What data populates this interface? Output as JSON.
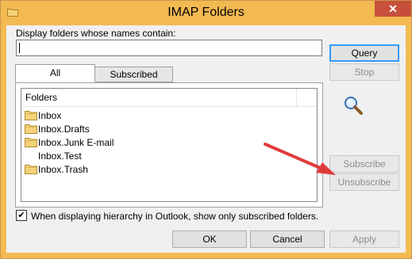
{
  "window": {
    "title": "IMAP Folders",
    "close_glyph": "✕"
  },
  "filter": {
    "label": "Display folders whose names contain:",
    "value": ""
  },
  "buttons": {
    "query": "Query",
    "stop": "Stop",
    "subscribe": "Subscribe",
    "unsubscribe": "Unsubscribe",
    "ok": "OK",
    "cancel": "Cancel",
    "apply": "Apply"
  },
  "tabs": [
    {
      "label": "All",
      "selected": true
    },
    {
      "label": "Subscribed",
      "selected": false
    }
  ],
  "folder_list": {
    "header": "Folders",
    "items": [
      {
        "name": "Inbox",
        "icon": "folder-icon"
      },
      {
        "name": "Inbox.Drafts",
        "icon": "folder-icon"
      },
      {
        "name": "Inbox.Junk E-mail",
        "icon": "folder-icon"
      },
      {
        "name": "Inbox.Test",
        "icon": ""
      },
      {
        "name": "Inbox.Trash",
        "icon": "folder-icon"
      }
    ]
  },
  "option": {
    "checked": true,
    "label": "When displaying hierarchy in Outlook, show only subscribed folders."
  },
  "colors": {
    "titlebar": "#f3ba52",
    "close": "#c7503b",
    "annotation_arrow": "#e03a3a",
    "focus": "#3399ff"
  },
  "icons": {
    "title": "folder-icon",
    "search": "magnifier-icon",
    "annotation": "red-arrow"
  }
}
